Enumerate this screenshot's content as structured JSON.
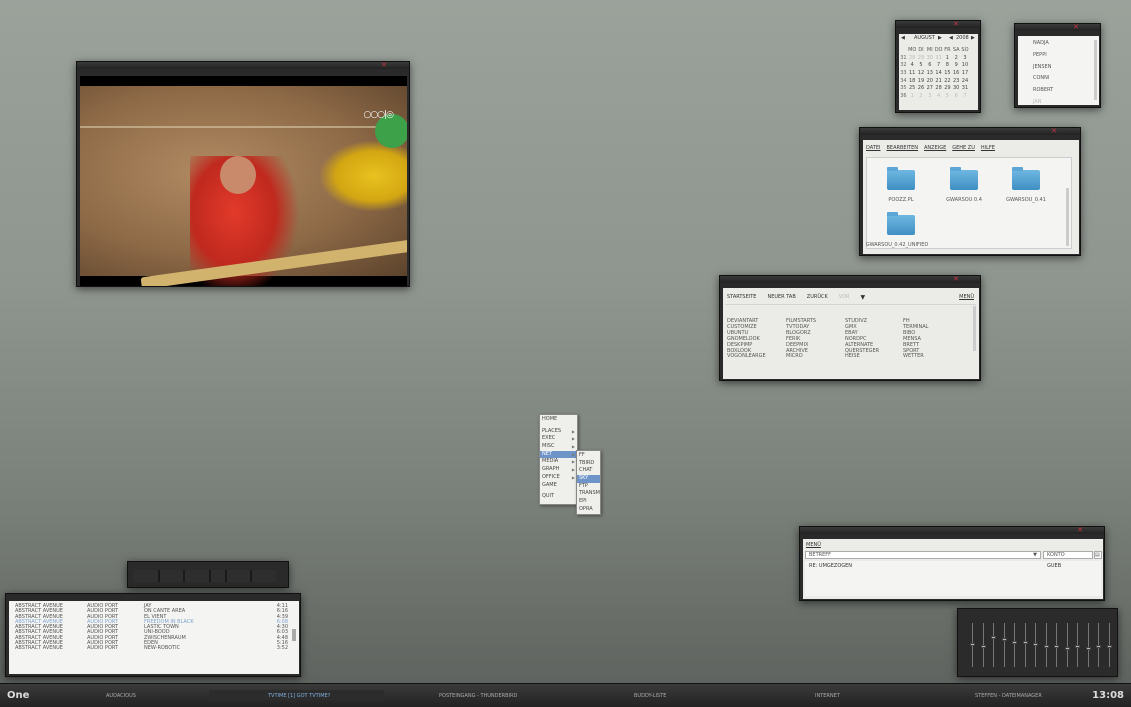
{
  "video_player": {
    "close_symbol": "✕",
    "overlay_logo": "○○○|◎"
  },
  "calendar": {
    "month": "AUGUST",
    "year": "2008",
    "weekday_headers": [
      "MO",
      "DI",
      "MI",
      "DO",
      "FR",
      "SA",
      "SO"
    ],
    "weeks": [
      {
        "wk": "31",
        "days": [
          "28",
          "29",
          "30",
          "31",
          "1",
          "2",
          "3"
        ],
        "dim": [
          true,
          true,
          true,
          true,
          false,
          false,
          false
        ]
      },
      {
        "wk": "32",
        "days": [
          "4",
          "5",
          "6",
          "7",
          "8",
          "9",
          "10"
        ],
        "dim": [
          false,
          false,
          false,
          false,
          false,
          false,
          false
        ]
      },
      {
        "wk": "33",
        "days": [
          "11",
          "12",
          "13",
          "14",
          "15",
          "16",
          "17"
        ],
        "dim": [
          false,
          false,
          false,
          false,
          false,
          false,
          false
        ]
      },
      {
        "wk": "34",
        "days": [
          "18",
          "19",
          "20",
          "21",
          "22",
          "23",
          "24"
        ],
        "dim": [
          false,
          false,
          false,
          false,
          false,
          false,
          false
        ]
      },
      {
        "wk": "35",
        "days": [
          "25",
          "26",
          "27",
          "28",
          "29",
          "30",
          "31"
        ],
        "dim": [
          false,
          false,
          false,
          false,
          false,
          false,
          false
        ]
      },
      {
        "wk": "36",
        "days": [
          "1",
          "2",
          "3",
          "4",
          "5",
          "6",
          "7"
        ],
        "dim": [
          true,
          true,
          true,
          true,
          true,
          true,
          true
        ]
      }
    ]
  },
  "buddy_list": {
    "items": [
      "NADJA",
      "PEPPI",
      "JENSEN",
      "CONNI",
      "ROBERT",
      "JAN"
    ],
    "dim": [
      false,
      false,
      false,
      false,
      false,
      true
    ]
  },
  "file_manager": {
    "menu": [
      "DATEI",
      "BEARBEITEN",
      "ANZEIGE",
      "GEHE ZU",
      "HILFE"
    ],
    "folders": [
      "POOZZ.PL",
      "GWARSOU 0.4",
      "GWARSOU_0.41",
      "GWARSOU_0.42_UNIFIED"
    ]
  },
  "browser": {
    "toolbar": [
      "STARTSEITE",
      "NEUER TAB",
      "ZURÜCK",
      "VOR"
    ],
    "menu_label": "MENÜ",
    "bookmarks": [
      [
        "DEVIANTART",
        "CUSTOMIZE",
        "UBUNTU",
        "GNOMELOOK",
        "DESKPIMP",
        "BOXLOOK",
        "VOGONLEARGE"
      ],
      [
        "FILMSTARTS",
        "TVTODAY",
        "BLOGORZ",
        "FERIK",
        "DEEPMIX",
        "ARCHIVE",
        "MICRO"
      ],
      [
        "STUDIVZ",
        "GMX",
        "EBAY",
        "NORDPC",
        "ALTERNATE",
        "QUERSTEGER",
        "HEISE"
      ],
      [
        "FH",
        "TERMINAL",
        "BIBO",
        "MENSA",
        "BRETT",
        "SPORT",
        "WETTER"
      ]
    ]
  },
  "start_menu": {
    "items": [
      {
        "label": "HOME",
        "sub": false
      },
      {
        "label": "PLACES",
        "sub": true
      },
      {
        "label": "EXEC",
        "sub": true
      },
      {
        "label": "MISC",
        "sub": true
      },
      {
        "label": "NET",
        "sub": true,
        "selected": true
      },
      {
        "label": "MEDIA",
        "sub": true
      },
      {
        "label": "GRAPH",
        "sub": true
      },
      {
        "label": "OFFICE",
        "sub": true
      },
      {
        "label": "GAME",
        "sub": false
      },
      {
        "label": "QUIT",
        "sub": false
      }
    ],
    "submenu": [
      {
        "label": "FF"
      },
      {
        "label": "TBIRD"
      },
      {
        "label": "CHAT"
      },
      {
        "label": "SKY",
        "selected": true
      },
      {
        "label": "FTP"
      },
      {
        "label": "TRANSM"
      },
      {
        "label": "EPI"
      },
      {
        "label": "OPRA"
      }
    ]
  },
  "mail_window": {
    "menu_label": "MENÜ",
    "subject_label": "BETREFF",
    "account_label": "KONTO",
    "row_subject": "RE: UMGEZOGEN",
    "row_from": "GUEB"
  },
  "audio_player": {
    "tracks": [
      {
        "artist": "ABSTRACT AVENUE",
        "album": "AUDIO PORT",
        "title": "JAY",
        "time": "4:11"
      },
      {
        "artist": "ABSTRACT AVENUE",
        "album": "AUDIO PORT",
        "title": "ON CANTE AREA",
        "time": "6:16"
      },
      {
        "artist": "ABSTRACT AVENUE",
        "album": "AUDIO PORT",
        "title": "EL VIENT",
        "time": "4:39"
      },
      {
        "artist": "ABSTRACT AVENUE",
        "album": "AUDIO PORT",
        "title": "FREEDOM IN BLACK",
        "time": "6:08",
        "playing": true
      },
      {
        "artist": "ABSTRACT AVENUE",
        "album": "AUDIO PORT",
        "title": "LASTIC TOWN",
        "time": "4:30"
      },
      {
        "artist": "ABSTRACT AVENUE",
        "album": "AUDIO PORT",
        "title": "UNI-BOOD",
        "time": "6:03"
      },
      {
        "artist": "ABSTRACT AVENUE",
        "album": "AUDIO PORT",
        "title": "ZWISCHENRAUM",
        "time": "4:48"
      },
      {
        "artist": "ABSTRACT AVENUE",
        "album": "AUDIO PORT",
        "title": "EDEN",
        "time": "5:16"
      },
      {
        "artist": "ABSTRACT AVENUE",
        "album": "AUDIO PORT",
        "title": "NEW-ROBOTIC",
        "time": "3:52"
      }
    ]
  },
  "mixer": {
    "levels": [
      0.55,
      0.5,
      0.7,
      0.65,
      0.6,
      0.6,
      0.55,
      0.5,
      0.5,
      0.45,
      0.5,
      0.45,
      0.5,
      0.5
    ]
  },
  "taskbar": {
    "workspace": "One",
    "tasks": [
      {
        "label": "AUDACIOUS",
        "active": false
      },
      {
        "label": "TVTIME [1] GOT TVTIME?",
        "active": true
      },
      {
        "label": "POSTEINGANG - THUNDERBIRD",
        "active": false
      },
      {
        "label": "BUDDY-LISTE",
        "active": false
      },
      {
        "label": "INTERNET",
        "active": false
      },
      {
        "label": "STEFFEN - DATEIMANAGER",
        "active": false
      }
    ],
    "clock": "13:08"
  },
  "colors": {
    "accent": "#6f95c8",
    "close": "#cc3344",
    "active_task": "#7fb0e0"
  }
}
